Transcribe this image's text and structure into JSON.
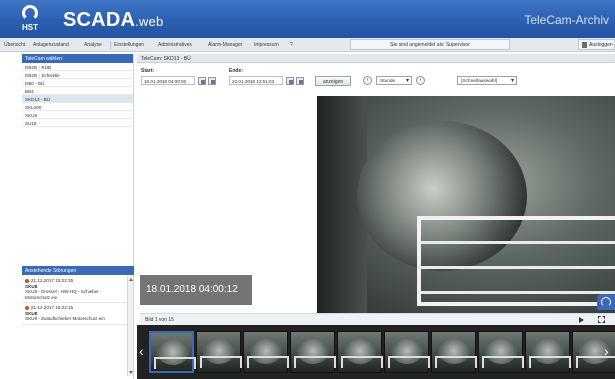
{
  "header": {
    "logo_text": "HST",
    "app_name": "SCADA",
    "app_suffix": ".web",
    "module": "TeleCam-Archiv"
  },
  "menu": {
    "items": [
      "Übersicht",
      "Anlagenzustand",
      "Analyse",
      "Einstellungen",
      "Administratives",
      "Alarm-Manager",
      "Impressum",
      "?"
    ],
    "logged_in": "Sie sind angemeldet als: Supervisor",
    "logout": "Ausloggen"
  },
  "left": {
    "header": "TeleCam wählen:",
    "items": [
      "DB2D - RÜB",
      "DB2D - Schwelle",
      "DB0 - BÜ",
      "BB4",
      "SKD13 - BÜ",
      "SKL000",
      "SKU8",
      "SU18"
    ],
    "selected_index": 4,
    "alarm_header": "Anstehende Störungen",
    "alarms": [
      {
        "date": "21.12.2017 15:22:35",
        "title": "SKU8",
        "desc": "SKU8 - Drossel - HW-HQ - Schieber - Motorschutz ein"
      },
      {
        "date": "21.12.2017 15:22:15",
        "title": "SKU8",
        "desc": "SKU8 - Zulaufschieber Motorschutz ein"
      }
    ]
  },
  "main": {
    "cam_title": "TeleCam: SKD13 - BÜ",
    "start_label": "Start:",
    "start_value": "18.01.2018 04:00:00",
    "end_label": "Ende:",
    "end_value": "22.01.2018 12:51:03",
    "show_button": "anzeigen",
    "step_select": "Stunde",
    "quick_select": "[Schnellauswahl]",
    "timestamp": "18.01.2018 04:00:12",
    "bild_text": "Bild 1 von 15",
    "thumb_count": 10
  },
  "colors": {
    "header_blue": "#2c5fb0",
    "panel_blue": "#3a69b7"
  }
}
